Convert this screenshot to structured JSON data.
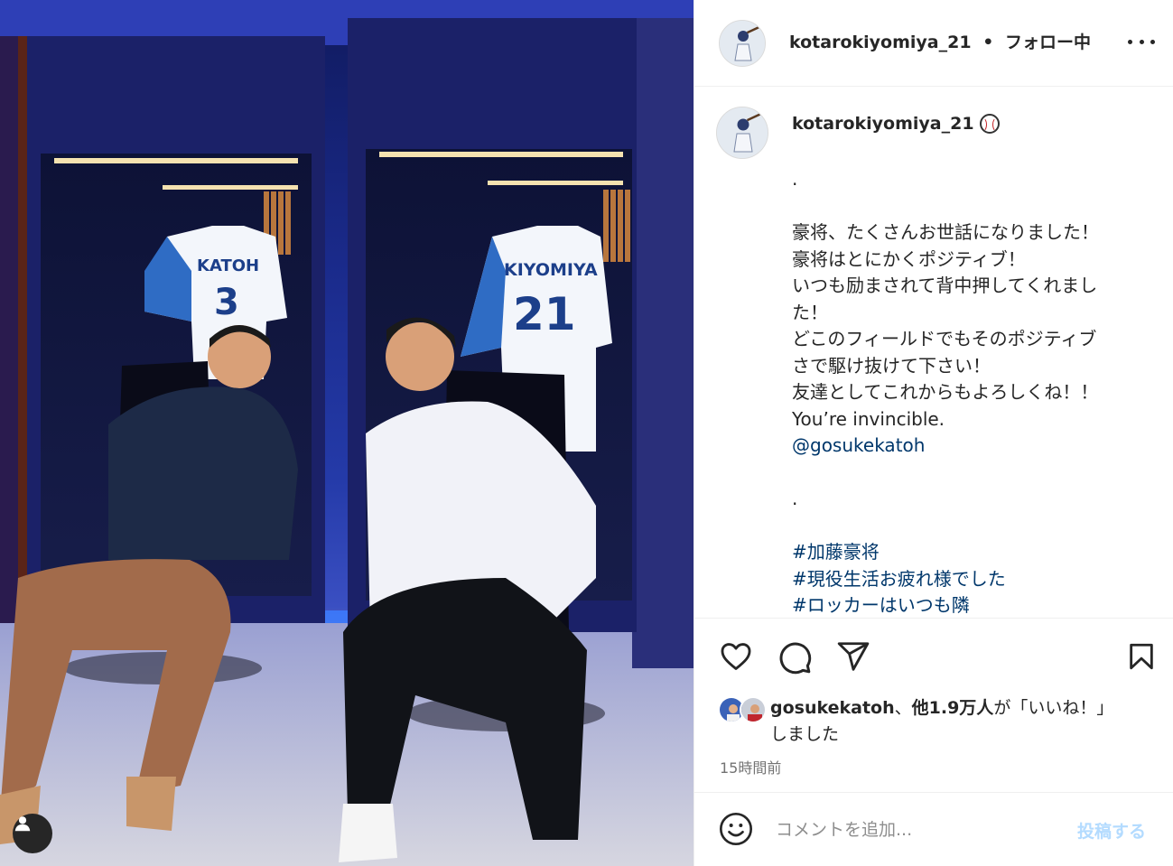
{
  "colors": {
    "text_primary": "#262626",
    "text_secondary": "#737373",
    "link": "#00376b",
    "post_button_disabled": "#b3dbff",
    "border": "#efefef"
  },
  "photo": {
    "jersey_left": {
      "name": "KATOH",
      "number": "3"
    },
    "jersey_right": {
      "name": "KIYOMIYA",
      "number": "21"
    }
  },
  "header": {
    "username": "kotarokiyomiya_21",
    "separator": "•",
    "follow_status": "フォロー中",
    "more_icon": "more-horizontal-icon"
  },
  "caption": {
    "username": "kotarokiyomiya_21",
    "verified_emoji": "baseball-icon",
    "lines": [
      ".",
      "",
      "豪将、たくさんお世話になりました！",
      "豪将はとにかくポジティブ！",
      "いつも励まされて背中押してくれまし",
      "た！",
      "どこのフィールドでもそのポジティブ",
      "さで駆け抜けて下さい！",
      "友達としてこれからもよろしくね！！",
      "You’re invincible.",
      "@gosukekatoh",
      "",
      ".",
      "",
      "#加藤豪将",
      "#現役生活お疲れ様でした",
      "#ロッカーはいつも隣"
    ]
  },
  "actions": {
    "icons": [
      "heart-icon",
      "comment-icon",
      "share-icon",
      "bookmark-icon"
    ],
    "likes_user": "gosukekatoh",
    "likes_mid": "、",
    "likes_count": "他1.9万人",
    "likes_suffix": "が「いいね！」",
    "likes_suffix2": "しました",
    "timestamp": "15時間前"
  },
  "comment": {
    "placeholder": "コメントを追加...",
    "post_label": "投稿する"
  }
}
